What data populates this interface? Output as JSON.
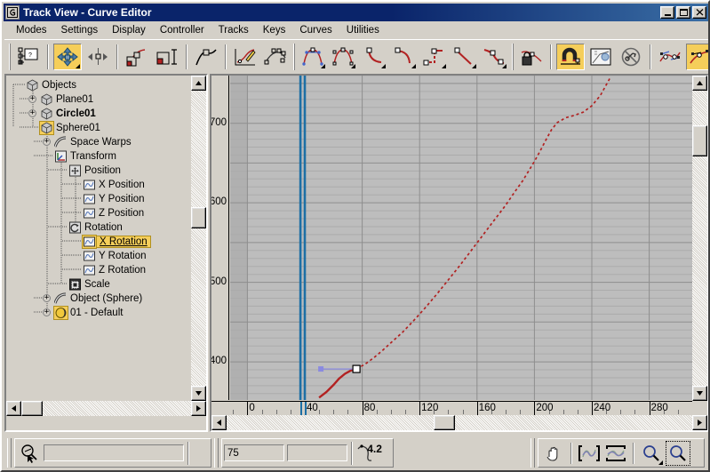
{
  "window": {
    "title": "Track View - Curve Editor",
    "app_icon": "trackview-icon",
    "minimize_label": "_",
    "maximize_label": "□",
    "close_label": "✕"
  },
  "menu": {
    "items": [
      {
        "label": "Modes"
      },
      {
        "label": "Settings"
      },
      {
        "label": "Display"
      },
      {
        "label": "Controller"
      },
      {
        "label": "Tracks"
      },
      {
        "label": "Keys"
      },
      {
        "label": "Curves"
      },
      {
        "label": "Utilities"
      }
    ]
  },
  "toolbar": {
    "groups": [
      {
        "buttons": [
          {
            "name": "filters-button",
            "icon": "filters-icon",
            "active": false,
            "flyout": false
          }
        ]
      },
      {
        "buttons": [
          {
            "name": "move-keys-button",
            "icon": "move-keys-icon",
            "active": true,
            "flyout": true
          },
          {
            "name": "slide-keys-button",
            "icon": "slide-keys-icon",
            "active": false,
            "flyout": false
          }
        ]
      },
      {
        "buttons": [
          {
            "name": "scale-keys-button",
            "icon": "scale-keys-icon",
            "active": false,
            "flyout": false
          },
          {
            "name": "scale-values-button",
            "icon": "scale-values-icon",
            "active": false,
            "flyout": false
          }
        ]
      },
      {
        "buttons": [
          {
            "name": "add-keys-button",
            "icon": "add-keys-icon",
            "active": false,
            "flyout": false
          }
        ]
      },
      {
        "buttons": [
          {
            "name": "draw-curves-button",
            "icon": "draw-curves-icon",
            "active": false,
            "flyout": false
          },
          {
            "name": "reduce-keys-button",
            "icon": "reduce-keys-icon",
            "active": false,
            "flyout": false
          }
        ]
      },
      {
        "buttons": [
          {
            "name": "tangent-smooth-button",
            "icon": "tangent-smooth-icon",
            "active": false,
            "flyout": true
          },
          {
            "name": "tangent-custom-button",
            "icon": "tangent-custom-icon",
            "active": false,
            "flyout": true
          },
          {
            "name": "tangent-fast-button",
            "icon": "tangent-fast-icon",
            "active": false,
            "flyout": true
          },
          {
            "name": "tangent-slow-button",
            "icon": "tangent-slow-icon",
            "active": false,
            "flyout": true
          },
          {
            "name": "tangent-step-button",
            "icon": "tangent-step-icon",
            "active": false,
            "flyout": true
          },
          {
            "name": "tangent-linear-button",
            "icon": "tangent-linear-icon",
            "active": false,
            "flyout": true
          },
          {
            "name": "tangent-smooth2-button",
            "icon": "tangent-smooth2-icon",
            "active": false,
            "flyout": true
          }
        ]
      },
      {
        "buttons": [
          {
            "name": "lock-tangents-button",
            "icon": "lock-tangents-icon",
            "active": false,
            "flyout": false
          }
        ]
      },
      {
        "buttons": [
          {
            "name": "snap-frames-button",
            "icon": "magnet-icon",
            "active": true,
            "flyout": false
          },
          {
            "name": "show-keyable-button",
            "icon": "keyable-icon",
            "active": false,
            "flyout": false
          },
          {
            "name": "lock-selection-button",
            "icon": "lock-selection-icon",
            "active": false,
            "flyout": false
          }
        ]
      },
      {
        "buttons": [
          {
            "name": "show-tangents-button",
            "icon": "show-tangents-icon",
            "active": false,
            "flyout": false
          },
          {
            "name": "show-all-tangents-button",
            "icon": "show-all-tangents-icon",
            "active": true,
            "flyout": false
          },
          {
            "name": "lock-tangents-2-button",
            "icon": "lock-tangents-2-icon",
            "active": false,
            "flyout": false
          }
        ]
      }
    ]
  },
  "tree": {
    "items": [
      {
        "label": "Objects",
        "indent": 0,
        "icon": "cube-icon",
        "expander": "",
        "bold": false,
        "selected": false,
        "icon_highlighted": false
      },
      {
        "label": "Plane01",
        "indent": 1,
        "icon": "cube-icon",
        "expander": "+",
        "bold": false,
        "selected": false,
        "icon_highlighted": false
      },
      {
        "label": "Circle01",
        "indent": 1,
        "icon": "cube-icon",
        "expander": "+",
        "bold": true,
        "selected": false,
        "icon_highlighted": false
      },
      {
        "label": "Sphere01",
        "indent": 1,
        "icon": "cube-icon",
        "expander": "",
        "bold": false,
        "selected": false,
        "icon_highlighted": true
      },
      {
        "label": "Space Warps",
        "indent": 2,
        "icon": "warp-icon",
        "expander": "+",
        "bold": false,
        "selected": false,
        "icon_highlighted": false
      },
      {
        "label": "Transform",
        "indent": 2,
        "icon": "transform-icon",
        "expander": "",
        "bold": false,
        "selected": false,
        "icon_highlighted": false
      },
      {
        "label": "Position",
        "indent": 3,
        "icon": "position-icon",
        "expander": "",
        "bold": false,
        "selected": false,
        "icon_highlighted": false
      },
      {
        "label": "X Position",
        "indent": 4,
        "icon": "curve-icon",
        "expander": "",
        "bold": false,
        "selected": false,
        "icon_highlighted": false
      },
      {
        "label": "Y Position",
        "indent": 4,
        "icon": "curve-icon",
        "expander": "",
        "bold": false,
        "selected": false,
        "icon_highlighted": false
      },
      {
        "label": "Z Position",
        "indent": 4,
        "icon": "curve-icon",
        "expander": "",
        "bold": false,
        "selected": false,
        "icon_highlighted": false
      },
      {
        "label": "Rotation",
        "indent": 3,
        "icon": "rotation-icon",
        "expander": "",
        "bold": false,
        "selected": false,
        "icon_highlighted": false
      },
      {
        "label": "X Rotation",
        "indent": 4,
        "icon": "curve-icon",
        "expander": "",
        "bold": false,
        "selected": true,
        "icon_highlighted": true
      },
      {
        "label": "Y Rotation",
        "indent": 4,
        "icon": "curve-icon",
        "expander": "",
        "bold": false,
        "selected": false,
        "icon_highlighted": false
      },
      {
        "label": "Z Rotation",
        "indent": 4,
        "icon": "curve-icon",
        "expander": "",
        "bold": false,
        "selected": false,
        "icon_highlighted": false
      },
      {
        "label": "Scale",
        "indent": 3,
        "icon": "scale-icon",
        "expander": "",
        "bold": false,
        "selected": false,
        "icon_highlighted": false
      },
      {
        "label": "Object (Sphere)",
        "indent": 2,
        "icon": "warp-icon",
        "expander": "+",
        "bold": false,
        "selected": false,
        "icon_highlighted": false
      },
      {
        "label": "01 - Default",
        "indent": 2,
        "icon": "material-icon",
        "expander": "+",
        "bold": false,
        "selected": false,
        "icon_highlighted": true
      }
    ]
  },
  "chart_data": {
    "type": "line",
    "title": "X Rotation",
    "xlabel": "",
    "ylabel": "",
    "xlim": [
      -12,
      310
    ],
    "ylim": [
      352,
      760
    ],
    "xticks": [
      0,
      40,
      80,
      120,
      160,
      200,
      240,
      280
    ],
    "yticks": [
      400,
      500,
      600,
      700
    ],
    "grid": true,
    "legend": false,
    "series": [
      {
        "name": "X Rotation",
        "color": "#b22222",
        "style": "dashed-after-key",
        "points": [
          [
            50,
            355
          ],
          [
            55,
            362
          ],
          [
            60,
            371
          ],
          [
            64,
            379
          ],
          [
            68,
            385
          ],
          [
            72,
            389
          ],
          [
            76,
            391
          ],
          [
            82,
            397
          ],
          [
            88,
            405
          ],
          [
            94,
            414
          ],
          [
            100,
            424
          ],
          [
            108,
            437
          ],
          [
            116,
            452
          ],
          [
            124,
            468
          ],
          [
            132,
            485
          ],
          [
            140,
            503
          ],
          [
            148,
            521
          ],
          [
            156,
            540
          ],
          [
            164,
            559
          ],
          [
            172,
            578
          ],
          [
            180,
            597
          ],
          [
            186,
            613
          ],
          [
            192,
            628
          ],
          [
            196,
            640
          ],
          [
            200,
            652
          ],
          [
            204,
            665
          ],
          [
            208,
            679
          ],
          [
            212,
            692
          ],
          [
            216,
            701
          ],
          [
            222,
            707
          ],
          [
            228,
            710
          ],
          [
            234,
            714
          ],
          [
            240,
            722
          ],
          [
            246,
            735
          ],
          [
            250,
            748
          ],
          [
            253,
            758
          ]
        ]
      }
    ],
    "keys": [
      {
        "frame": 76,
        "value": 391,
        "selected": true,
        "tangent_handle": "in-flat-left"
      }
    ],
    "time_markers": [
      37,
      40
    ]
  },
  "status": {
    "selection_icon": "zoom-select-icon",
    "selection_field_value": "",
    "frame_field_value": "75",
    "value_field_value": "",
    "value_label": "4.2",
    "value_label_icon": "key-value-icon",
    "nav_buttons": [
      {
        "name": "pan-button",
        "icon": "hand-icon",
        "active": false
      },
      {
        "name": "zoom-horizontal-extents-button",
        "icon": "zoom-horizontal-extents-icon",
        "active": false
      },
      {
        "name": "zoom-value-extents-button",
        "icon": "zoom-value-extents-icon",
        "active": false
      },
      {
        "name": "zoom-button",
        "icon": "magnifier-icon",
        "active": false
      },
      {
        "name": "zoom-region-button",
        "icon": "zoom-region-icon",
        "active": true
      }
    ]
  },
  "scrollbars": {
    "tree_vertical": {
      "up": "▲",
      "down": "▼"
    },
    "tree_horizontal": {
      "left": "◄",
      "right": "►"
    },
    "graph_vertical": {
      "up": "▲",
      "down": "▼"
    },
    "graph_horizontal": {
      "left": "◄",
      "right": "►"
    }
  }
}
